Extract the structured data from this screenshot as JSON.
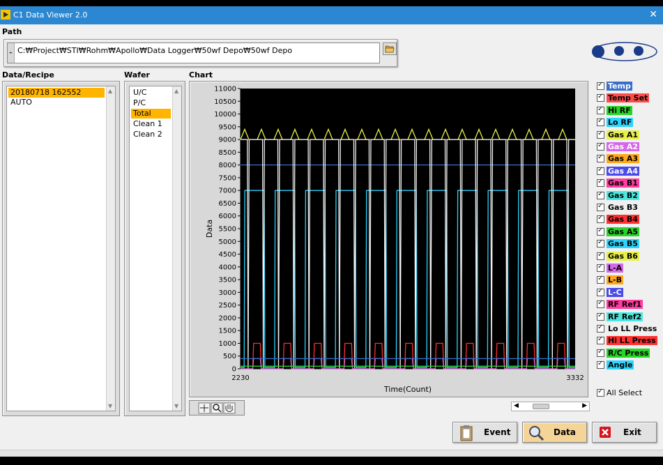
{
  "window": {
    "title": "C1 Data Viewer 2.0",
    "close_glyph": "✕"
  },
  "path": {
    "label": "Path",
    "value": "C:₩Project₩STI₩Rohm₩Apollo₩Data Logger₩50wf Depo₩50wf Depo"
  },
  "data_recipe": {
    "label": "Data/Recipe",
    "items": [
      "20180718 162552 AUTO"
    ],
    "selected": 0
  },
  "wafer": {
    "label": "Wafer",
    "items": [
      "U/C",
      "P/C",
      "Total",
      "Clean 1",
      "Clean 2"
    ],
    "selected": 2
  },
  "chart": {
    "label": "Chart"
  },
  "legend": {
    "items": [
      {
        "label": "Temp",
        "bg": "#3b6ec9",
        "fg": "#ffffff"
      },
      {
        "label": "Temp Set",
        "bg": "#ff4b4b",
        "fg": "#000000"
      },
      {
        "label": "Hi RF",
        "bg": "#28d428",
        "fg": "#000000"
      },
      {
        "label": "Lo RF",
        "bg": "#2ad5ff",
        "fg": "#000000"
      },
      {
        "label": "Gas A1",
        "bg": "#e8f04a",
        "fg": "#000000"
      },
      {
        "label": "Gas A2",
        "bg": "#d468e8",
        "fg": "#ffffff"
      },
      {
        "label": "Gas A3",
        "bg": "#ffa81c",
        "fg": "#000000"
      },
      {
        "label": "Gas A4",
        "bg": "#4a4ae8",
        "fg": "#ffffff"
      },
      {
        "label": "Gas B1",
        "bg": "#ff3ca0",
        "fg": "#000000"
      },
      {
        "label": "Gas B2",
        "bg": "#4ae8e0",
        "fg": "#000000"
      },
      {
        "label": "Gas B3",
        "bg": "#f0f0f0",
        "fg": "#000000"
      },
      {
        "label": "Gas B4",
        "bg": "#ff3030",
        "fg": "#000000"
      },
      {
        "label": "Gas A5",
        "bg": "#28d428",
        "fg": "#000000"
      },
      {
        "label": "Gas B5",
        "bg": "#2ad5ff",
        "fg": "#000000"
      },
      {
        "label": "Gas B6",
        "bg": "#e8f04a",
        "fg": "#000000"
      },
      {
        "label": "L-A",
        "bg": "#d468e8",
        "fg": "#000000"
      },
      {
        "label": "L-B",
        "bg": "#ffa81c",
        "fg": "#000000"
      },
      {
        "label": "L-C",
        "bg": "#4a4ae8",
        "fg": "#ffffff"
      },
      {
        "label": "RF Ref1",
        "bg": "#ff3ca0",
        "fg": "#000000"
      },
      {
        "label": "RF Ref2",
        "bg": "#4ae8e0",
        "fg": "#000000"
      },
      {
        "label": "Lo LL Press",
        "bg": "#f0f0f0",
        "fg": "#000000"
      },
      {
        "label": "Hi LL Press",
        "bg": "#ff3030",
        "fg": "#000000"
      },
      {
        "label": "R/C Press",
        "bg": "#28d428",
        "fg": "#000000"
      },
      {
        "label": "Angle",
        "bg": "#2ad5ff",
        "fg": "#000000"
      }
    ],
    "all_select": "All Select"
  },
  "buttons": {
    "event": "Event",
    "data": "Data",
    "exit": "Exit"
  },
  "chart_data": {
    "type": "line",
    "xlabel": "Time(Count)",
    "ylabel": "Data",
    "xlim": [
      2230,
      3332
    ],
    "ylim": [
      0,
      11000
    ],
    "x_ticks": [
      "2230",
      "3332"
    ],
    "y_ticks": [
      "0",
      "500",
      "1000",
      "1500",
      "2000",
      "2500",
      "3000",
      "3500",
      "4000",
      "4500",
      "5000",
      "5500",
      "6000",
      "6500",
      "7000",
      "7500",
      "8000",
      "8500",
      "9000",
      "9500",
      "10000",
      "10500",
      "11000"
    ],
    "grid": false,
    "background": "#000000",
    "series": [
      {
        "color": "#2ad5ff",
        "pattern": "pulses",
        "high": 7000,
        "low": 50,
        "cycles": 11
      },
      {
        "color": "#e8f04a",
        "pattern": "flat_spiky",
        "level": 9000
      },
      {
        "color": "#ff4b4b",
        "pattern": "flat",
        "level": 9000
      },
      {
        "color": "#3b6ec9",
        "pattern": "flat",
        "level": 8000
      },
      {
        "color": "#f0f0f0",
        "pattern": "dips",
        "level": 9000,
        "low": 0,
        "cycles": 22
      },
      {
        "color": "#ff3030",
        "pattern": "small_pulses",
        "high": 1000,
        "cycles": 11
      },
      {
        "color": "#d468e8",
        "pattern": "small_pulses",
        "high": 400,
        "cycles": 11
      },
      {
        "color": "#3b6ec9",
        "pattern": "flat",
        "level": 400
      },
      {
        "color": "#28d428",
        "pattern": "flat",
        "level": 100
      }
    ]
  }
}
